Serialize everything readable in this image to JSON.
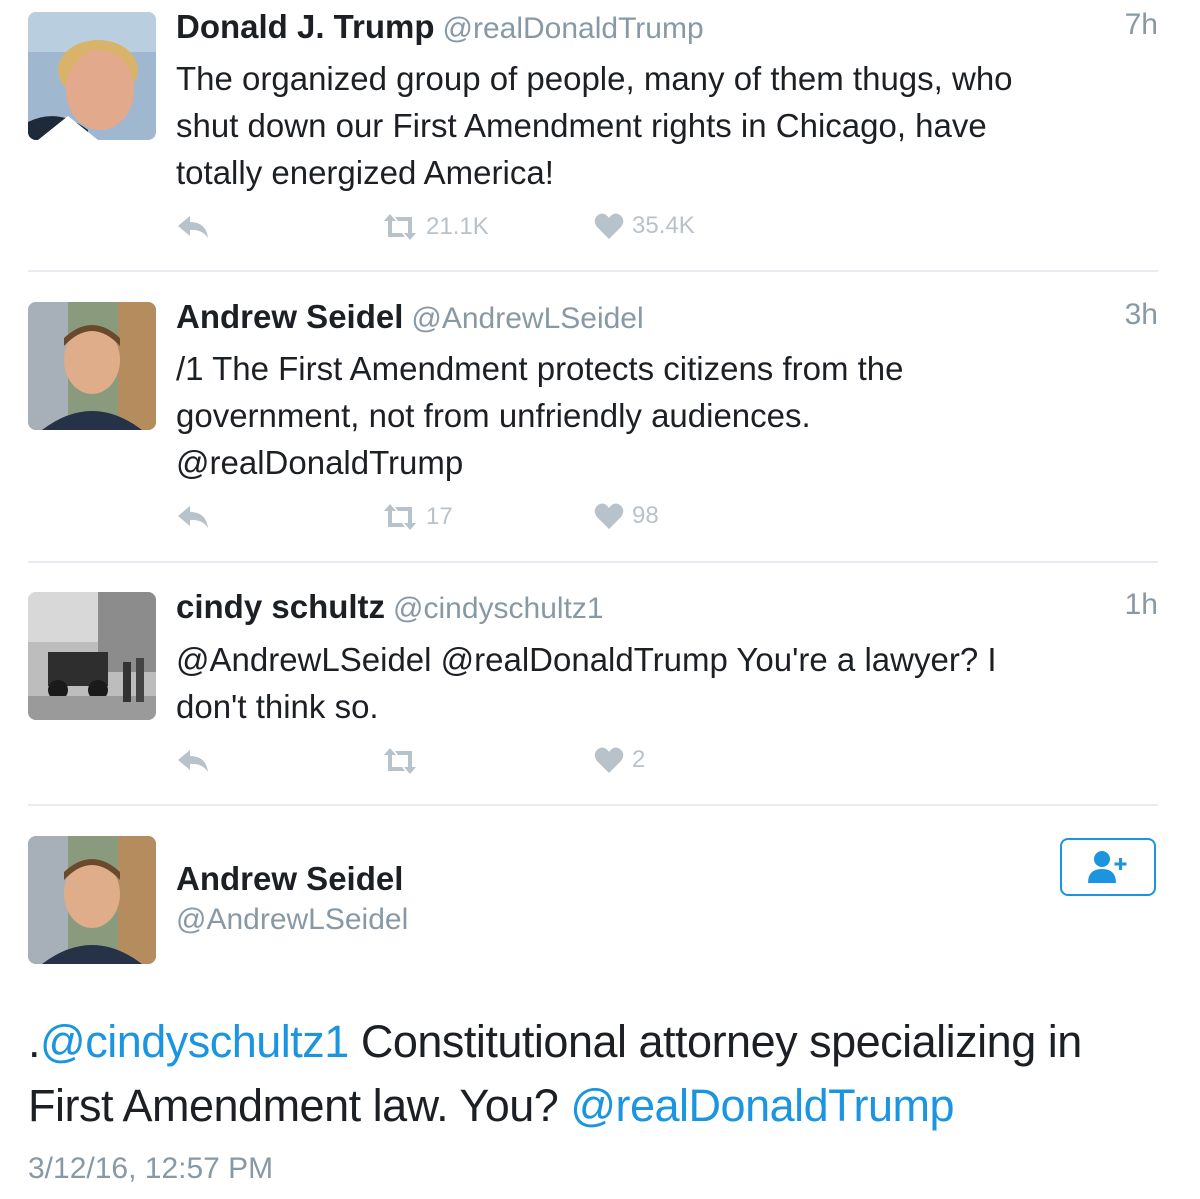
{
  "tweets": [
    {
      "name": "Donald J. Trump",
      "handle": "@realDonaldTrump",
      "time": "7h",
      "text": "The organized group of people, many of them thugs, who\nshut down our First Amendment rights in Chicago, have\ntotally energized America!",
      "retweets": "21.1K",
      "likes": "35.4K"
    },
    {
      "name": "Andrew Seidel",
      "handle": "@AndrewLSeidel",
      "time": "3h",
      "text": "/1 The First Amendment protects citizens from the\ngovernment, not from unfriendly audiences.\n@realDonaldTrump",
      "retweets": "17",
      "likes": "98"
    },
    {
      "name": "cindy schultz",
      "handle": "@cindyschultz1",
      "time": "1h",
      "text": "@AndrewLSeidel @realDonaldTrump You're a lawyer?  I\ndon't think so.",
      "retweets": "",
      "likes": "2"
    }
  ],
  "detail": {
    "name": "Andrew Seidel",
    "handle": "@AndrewLSeidel",
    "text_prefix": ".",
    "mention1": "@cindyschultz1",
    "text_mid": " Constitutional attorney specializing in First Amendment law. You? ",
    "mention2": "@realDonaldTrump",
    "datetime": "3/12/16, 12:57 PM"
  },
  "icons": {
    "reply": "reply-icon",
    "retweet": "retweet-icon",
    "like": "heart-icon",
    "follow": "add-user-icon"
  },
  "colors": {
    "link": "#1b95e0",
    "muted": "#8899a6",
    "action_icon": "#b7c2cb",
    "divider": "#e6ecf0"
  }
}
